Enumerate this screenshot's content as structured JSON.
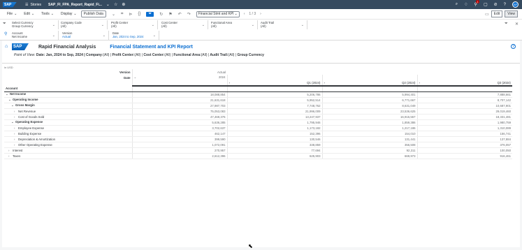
{
  "shell": {
    "logo": "SAP",
    "menu_icon": "hamburger-icon",
    "stories_label": "Stories",
    "story_title": "SAP_FI_FPA_Report_Rapid_Fi...",
    "avatar_initials": "AF",
    "notification_count": "1"
  },
  "toolbar": {
    "file": "File",
    "edit": "Edit",
    "tools": "Tools",
    "display": "Display",
    "publish": "Publish Data",
    "page_select": "Financial Stmt and KPI",
    "page_counter": "1 / 3",
    "edit_btn": "Edit",
    "view_btn": "View"
  },
  "filters": {
    "currency": {
      "label": "Select Currency",
      "value": "Group Currency"
    },
    "company_code": {
      "label": "Company Code",
      "value": "(All)"
    },
    "profit_center": {
      "label": "Profit Center",
      "value": "(All)"
    },
    "cost_center": {
      "label": "Cost Center",
      "value": "(All)"
    },
    "functional_area": {
      "label": "Functional Area",
      "value": "(All)"
    },
    "audit_trail": {
      "label": "Audit Trail",
      "value": "(All)"
    },
    "account": {
      "label": "Account",
      "value": "Net Income"
    },
    "version": {
      "label": "Version",
      "value": "Actual"
    },
    "date": {
      "label": "Date",
      "value": "Jan, 2024 to Sep, 2024"
    }
  },
  "header": {
    "logo": "SAP",
    "title": "Rapid Financial Analysis",
    "subtitle": "Financial Statement and KPI Report"
  },
  "pov": {
    "prefix": "Point of View:",
    "date_label": "Date:",
    "date_value": " Jan, 2024 to Sep, 2024 |",
    "company_label": " Company:",
    "company_value": "(All) |",
    "profit_label": " Profit Center:",
    "profit_value": "(All) |",
    "cost_label": " Cost Center:",
    "cost_value": "(All) |",
    "func_label": " Functional Area:",
    "func_value": "(All) |",
    "audit_label": " Audit Trail:",
    "audit_value": "(All) |",
    "currency": " Group Currency"
  },
  "table": {
    "unit": "in USD",
    "version_label": "Version",
    "date_label": "Date",
    "account_label": "Account",
    "version_value": "Actual",
    "year_value": "2024",
    "columns": [
      "Q1 (2024)",
      "Q2 (2024)",
      "Q3 (2024)"
    ],
    "rows": [
      {
        "label": "Net Income",
        "values": [
          "18,088,854",
          "5,206,786",
          "5,994,401",
          "7,888,661"
        ]
      },
      {
        "label": "Operating Income",
        "values": [
          "21,631,618",
          "5,952,514",
          "6,771,667",
          "8,707,142"
        ]
      },
      {
        "label": "Gross Margin",
        "values": [
          "27,987,703",
          "7,748,762",
          "8,631,049",
          "10,687,901"
        ]
      },
      {
        "label": "Net Revenue",
        "values": [
          "75,053,083",
          "21,996,009",
          "23,536,625",
          "29,019,460"
        ]
      },
      {
        "label": "Cost of Goods Sold",
        "values": [
          "47,469,376",
          "13,247,937",
          "16,915,557",
          "18,331,481"
        ]
      },
      {
        "label": "Operating Expense",
        "values": [
          "5,636,285",
          "1,795,946",
          "1,859,386",
          "1,980,759"
        ]
      },
      {
        "label": "Employee Expense",
        "values": [
          "3,702,637",
          "1,173,182",
          "1,217,186",
          "1,310,089"
        ]
      },
      {
        "label": "Building Expense",
        "values": [
          "462,147",
          "152,396",
          "154,010",
          "156,741"
        ]
      },
      {
        "label": "Depreciation & Amortization",
        "values": [
          "399,590",
          "130,546",
          "131,441",
          "137,884"
        ]
      },
      {
        "label": "Other Operating Expense",
        "values": [
          "1,072,091",
          "338,859",
          "356,508",
          "376,057"
        ]
      },
      {
        "label": "Interest",
        "values": [
          "270,957",
          "77,694",
          "92,311",
          "100,050"
        ]
      },
      {
        "label": "Taxes",
        "values": [
          "2,612,396",
          "625,903",
          "669,973",
          "916,461"
        ]
      }
    ]
  }
}
